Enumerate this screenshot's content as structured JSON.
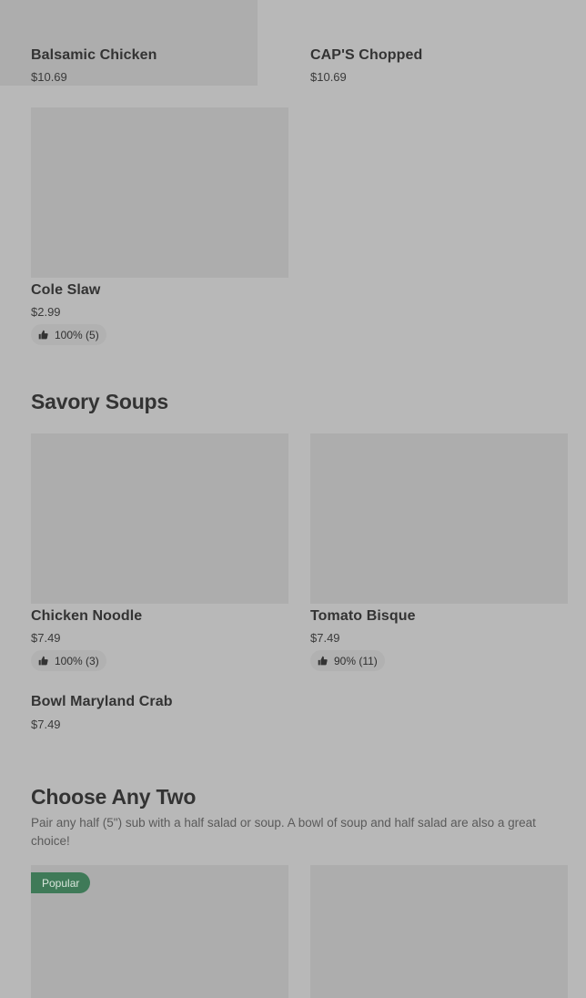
{
  "top_row": {
    "items": [
      {
        "name": "Balsamic Chicken",
        "price": "$10.69"
      },
      {
        "name": "CAP'S Chopped",
        "price": "$10.69"
      }
    ]
  },
  "salads_row2": {
    "items": [
      {
        "name": "Cole Slaw",
        "price": "$2.99",
        "rating": "100% (5)"
      }
    ]
  },
  "savory_soups": {
    "title": "Savory Soups",
    "items": [
      {
        "name": "Chicken Noodle",
        "price": "$7.49",
        "rating": "100% (3)"
      },
      {
        "name": "Tomato Bisque",
        "price": "$7.49",
        "rating": "90% (11)"
      },
      {
        "name": "Bowl Maryland Crab",
        "price": "$7.49"
      }
    ]
  },
  "choose_any_two": {
    "title": "Choose Any Two",
    "description": "Pair any half (5\") sub with a half salad or soup. A bowl of soup and half salad are also a great choice!",
    "badge": "Popular"
  },
  "icons": {
    "rating": "thumbs-up-icon"
  },
  "colors": {
    "background": "#b8b8b8",
    "image_placeholder": "#adadad",
    "popular_badge": "#3f7a58"
  }
}
